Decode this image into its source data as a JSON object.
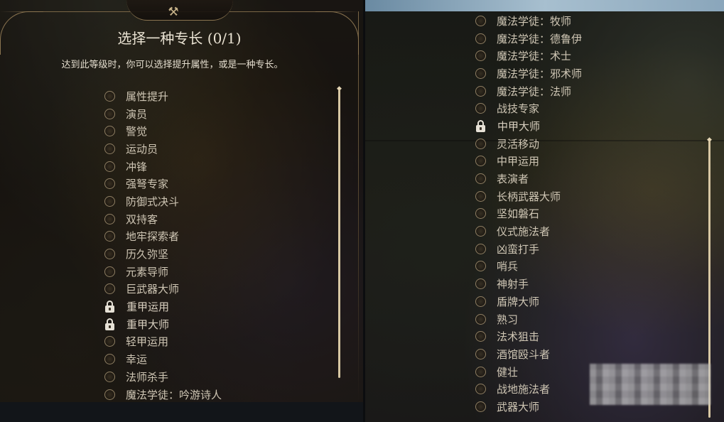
{
  "left_panel": {
    "title": "选择一种专长 (0/1)",
    "subtitle": "达到此等级时，你可以选择提升属性，或是一种专长。",
    "crest_icon": "crossed-tools-icon",
    "feats": [
      {
        "label": "属性提升",
        "locked": false
      },
      {
        "label": "演员",
        "locked": false
      },
      {
        "label": "警觉",
        "locked": false
      },
      {
        "label": "运动员",
        "locked": false
      },
      {
        "label": "冲锋",
        "locked": false
      },
      {
        "label": "强弩专家",
        "locked": false
      },
      {
        "label": "防御式决斗",
        "locked": false
      },
      {
        "label": "双持客",
        "locked": false
      },
      {
        "label": "地牢探索者",
        "locked": false
      },
      {
        "label": "历久弥坚",
        "locked": false
      },
      {
        "label": "元素导师",
        "locked": false
      },
      {
        "label": "巨武器大师",
        "locked": false
      },
      {
        "label": "重甲运用",
        "locked": true
      },
      {
        "label": "重甲大师",
        "locked": true
      },
      {
        "label": "轻甲运用",
        "locked": false
      },
      {
        "label": "幸运",
        "locked": false
      },
      {
        "label": "法师杀手",
        "locked": false
      },
      {
        "label": "魔法学徒：吟游诗人",
        "locked": false
      }
    ]
  },
  "right_panel": {
    "feats": [
      {
        "label": "魔法学徒：牧师",
        "locked": false
      },
      {
        "label": "魔法学徒：德鲁伊",
        "locked": false
      },
      {
        "label": "魔法学徒：术士",
        "locked": false
      },
      {
        "label": "魔法学徒：邪术师",
        "locked": false
      },
      {
        "label": "魔法学徒：法师",
        "locked": false
      },
      {
        "label": "战技专家",
        "locked": false
      },
      {
        "label": "中甲大师",
        "locked": true
      },
      {
        "label": "灵活移动",
        "locked": false
      },
      {
        "label": "中甲运用",
        "locked": false
      },
      {
        "label": "表演者",
        "locked": false
      },
      {
        "label": "长柄武器大师",
        "locked": false
      },
      {
        "label": "坚如磐石",
        "locked": false
      },
      {
        "label": "仪式施法者",
        "locked": false
      },
      {
        "label": "凶蛮打手",
        "locked": false
      },
      {
        "label": "哨兵",
        "locked": false
      },
      {
        "label": "神射手",
        "locked": false
      },
      {
        "label": "盾牌大师",
        "locked": false
      },
      {
        "label": "熟习",
        "locked": false
      },
      {
        "label": "法术狙击",
        "locked": false
      },
      {
        "label": "酒馆殴斗者",
        "locked": false
      },
      {
        "label": "健壮",
        "locked": false
      },
      {
        "label": "战地施法者",
        "locked": false
      },
      {
        "label": "武器大师",
        "locked": false
      }
    ]
  },
  "colors": {
    "text": "#cfc6b4",
    "title": "#e9e2d2",
    "frame_gold": "#8a7450",
    "scrollbar": "#d7c7a3"
  }
}
